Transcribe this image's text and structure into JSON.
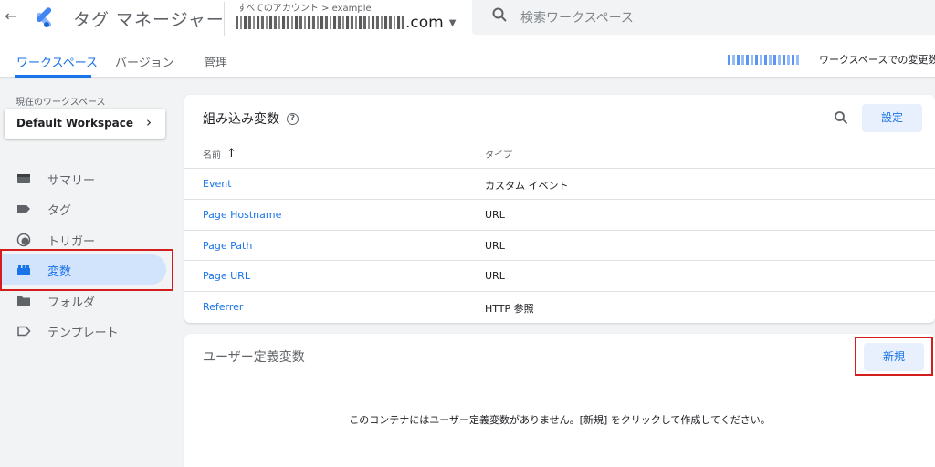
{
  "header": {
    "back_icon": "arrow-back-icon",
    "logo_icon": "tag-manager-logo",
    "app_title": "タグ マネージャー",
    "account_breadcrumb": "すべてのアカウント > example",
    "container_suffix": ".com",
    "search_placeholder": "検索ワークスペース"
  },
  "tabs": [
    {
      "label": "ワークスペース",
      "active": true
    },
    {
      "label": "バージョン",
      "active": false
    },
    {
      "label": "管理",
      "active": false
    }
  ],
  "workspace_changes_label": "ワークスペースでの変更数",
  "sidebar": {
    "current_ws_label": "現在のワークスペース",
    "workspace_name": "Default Workspace",
    "items": [
      {
        "label": "サマリー",
        "icon": "summary-icon",
        "active": false
      },
      {
        "label": "タグ",
        "icon": "tag-icon",
        "active": false
      },
      {
        "label": "トリガー",
        "icon": "trigger-icon",
        "active": false
      },
      {
        "label": "変数",
        "icon": "variables-icon",
        "active": true
      },
      {
        "label": "フォルダ",
        "icon": "folder-icon",
        "active": false
      },
      {
        "label": "テンプレート",
        "icon": "template-icon",
        "active": false
      }
    ]
  },
  "builtin": {
    "title": "組み込み変数",
    "settings_label": "設定",
    "col_name": "名前",
    "col_type": "タイプ",
    "rows": [
      {
        "name": "Event",
        "type": "カスタム イベント"
      },
      {
        "name": "Page Hostname",
        "type": "URL"
      },
      {
        "name": "Page Path",
        "type": "URL"
      },
      {
        "name": "Page URL",
        "type": "URL"
      },
      {
        "name": "Referrer",
        "type": "HTTP 参照"
      }
    ]
  },
  "user_defined": {
    "title": "ユーザー定義変数",
    "new_label": "新規",
    "empty_message": "このコンテナにはユーザー定義変数がありません。[新規] をクリックして作成してください。"
  },
  "colors": {
    "accent": "#1a73e8",
    "active_nav_bg": "#d2e3fc",
    "highlight_border": "#d41e1e"
  }
}
